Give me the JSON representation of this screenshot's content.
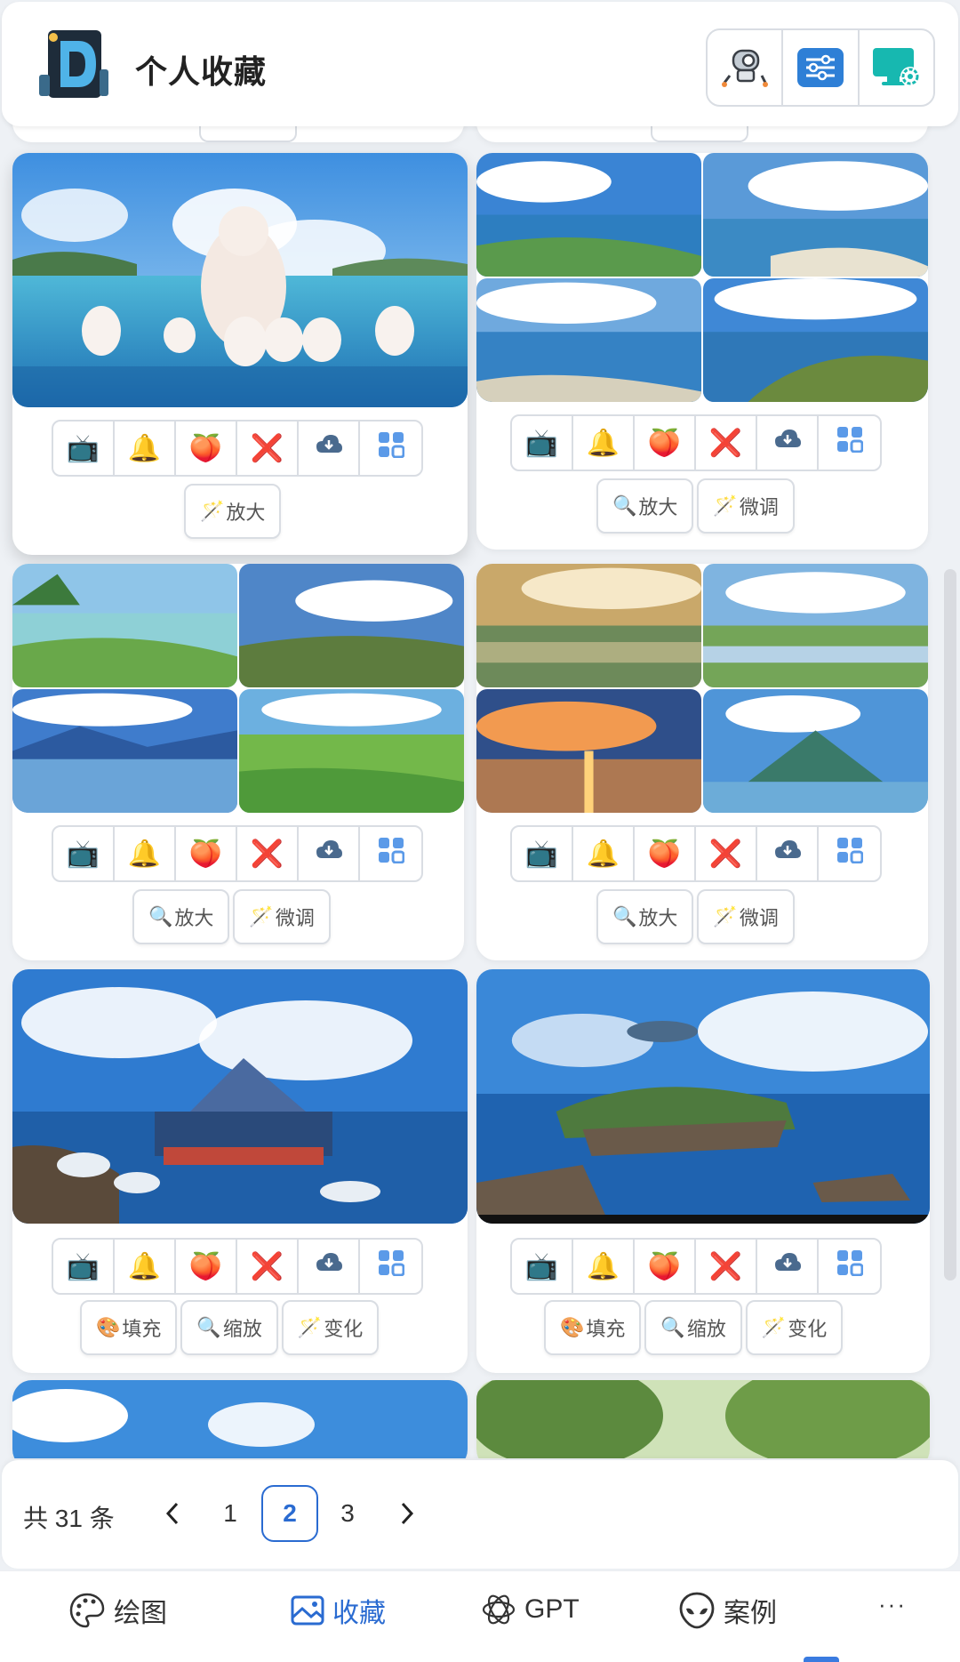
{
  "header": {
    "title": "个人收藏",
    "buttons": [
      {
        "name": "robot-icon"
      },
      {
        "name": "sliders-icon"
      },
      {
        "name": "monitor-settings-icon"
      }
    ]
  },
  "toolbar_icons": [
    "📺",
    "🔔",
    "🍑",
    "❌",
    "download-icon",
    "grid-icon"
  ],
  "cards": [
    {
      "id": "c1",
      "actions": [
        {
          "icon": "🪄",
          "label": "放大"
        }
      ]
    },
    {
      "id": "c2",
      "actions": [
        {
          "icon": "🔍",
          "label": "放大"
        },
        {
          "icon": "🪄",
          "label": "微调"
        }
      ]
    },
    {
      "id": "c3",
      "actions": [
        {
          "icon": "🔍",
          "label": "放大"
        },
        {
          "icon": "🪄",
          "label": "微调"
        }
      ]
    },
    {
      "id": "c4",
      "actions": [
        {
          "icon": "🔍",
          "label": "放大"
        },
        {
          "icon": "🪄",
          "label": "微调"
        }
      ]
    },
    {
      "id": "c5",
      "actions": [
        {
          "icon": "🎨",
          "label": "填充"
        },
        {
          "icon": "🔍",
          "label": "缩放"
        },
        {
          "icon": "🪄",
          "label": "变化"
        }
      ]
    },
    {
      "id": "c6",
      "actions": [
        {
          "icon": "🎨",
          "label": "填充"
        },
        {
          "icon": "🔍",
          "label": "缩放"
        },
        {
          "icon": "🪄",
          "label": "变化"
        }
      ]
    }
  ],
  "pagination": {
    "total_text": "共 31 条",
    "pages": [
      "1",
      "2",
      "3"
    ],
    "current": "2",
    "prev": "‹",
    "next": "›"
  },
  "nav": {
    "items": [
      {
        "label": "绘图",
        "icon": "palette-icon"
      },
      {
        "label": "收藏",
        "icon": "gallery-icon",
        "active": true
      },
      {
        "label": "GPT",
        "icon": "openai-icon"
      },
      {
        "label": "案例",
        "icon": "alien-icon"
      }
    ],
    "more": "···"
  },
  "colors": {
    "accent": "#2a6bd1",
    "border": "#d9dde3",
    "background": "#eef1f5"
  }
}
